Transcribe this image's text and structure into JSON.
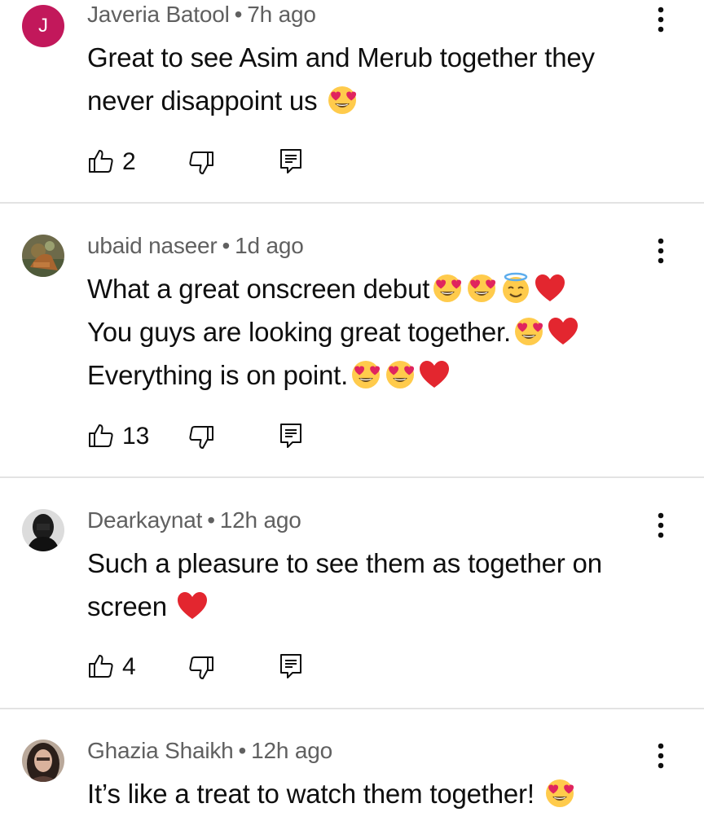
{
  "comments": [
    {
      "author": "Javeria Batool",
      "separator": "•",
      "time": "7h ago",
      "avatar_letter": "J",
      "avatar_color": "#c2185b",
      "lines": [
        {
          "text": "Great to see Asim and Merub together they",
          "emojis": []
        },
        {
          "text": "never disappoint us ",
          "emojis": [
            "heart-eyes"
          ]
        }
      ],
      "likes": "2"
    },
    {
      "author": "ubaid naseer",
      "separator": "•",
      "time": "1d ago",
      "lines": [
        {
          "text": "What a great onscreen debut",
          "emojis": [
            "heart-eyes",
            "heart-eyes",
            "halo",
            "red-heart"
          ]
        },
        {
          "text": "You guys are looking great together.",
          "emojis": [
            "heart-eyes",
            "red-heart"
          ]
        },
        {
          "text": "Everything is on point.",
          "emojis": [
            "heart-eyes",
            "heart-eyes",
            "red-heart"
          ]
        }
      ],
      "likes": "13"
    },
    {
      "author": "Dearkaynat",
      "separator": "•",
      "time": "12h ago",
      "lines": [
        {
          "text": "Such a pleasure to see them as together on",
          "emojis": []
        },
        {
          "text": "screen ",
          "emojis": [
            "red-heart"
          ]
        }
      ],
      "likes": "4"
    },
    {
      "author": "Ghazia Shaikh",
      "separator": "•",
      "time": "12h ago",
      "lines": [
        {
          "text": "It’s like a treat to watch them together! ",
          "emojis": [
            "heart-eyes"
          ]
        }
      ]
    }
  ]
}
